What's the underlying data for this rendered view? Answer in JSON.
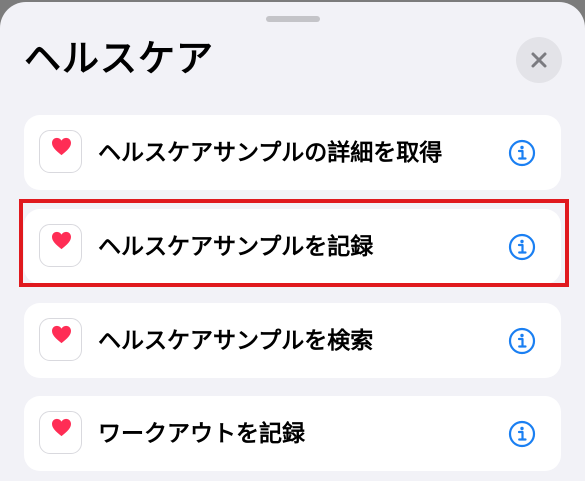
{
  "sheet": {
    "title": "ヘルスケア"
  },
  "actions": [
    {
      "label": "ヘルスケアサンプルの詳細を取得",
      "icon": "heart-icon"
    },
    {
      "label": "ヘルスケアサンプルを記録",
      "icon": "heart-icon"
    },
    {
      "label": "ヘルスケアサンプルを検索",
      "icon": "heart-icon"
    },
    {
      "label": "ワークアウトを記録",
      "icon": "heart-icon"
    }
  ],
  "highlighted_action": "ヘルスケアサンプルを記録",
  "colors": {
    "accent": "#1a7ff2",
    "heart": "#ff2d55",
    "highlight_border": "#e0191e"
  }
}
